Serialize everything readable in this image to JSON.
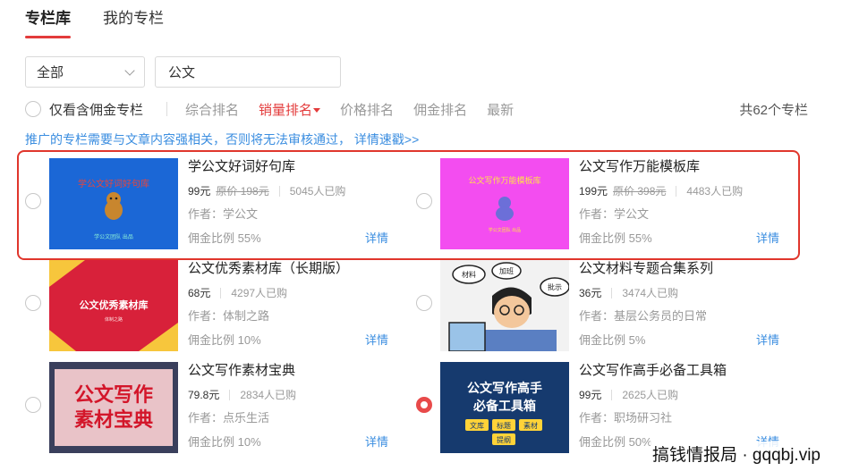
{
  "tabs": [
    {
      "label": "专栏库",
      "active": true
    },
    {
      "label": "我的专栏",
      "active": false
    }
  ],
  "filter": {
    "category": "全部",
    "search_value": "公文"
  },
  "sort": {
    "commission_only_label": "仅看含佣金专栏",
    "options": [
      "综合排名",
      "销量排名",
      "价格排名",
      "佣金排名",
      "最新"
    ],
    "active_option": "销量排名",
    "total": "共62个专栏"
  },
  "notice": "推广的专栏需要与文章内容强相关，否则将无法审核通过， 详情速戳>>",
  "columns": [
    {
      "title": "学公文好词好句库",
      "price": "99元",
      "orig_price": "原价 198元",
      "sold": "5045人已购",
      "author": "作者：学公文",
      "rate": "佣金比例 55%",
      "detail": "详情",
      "thumb": {
        "headline": "学公文好词好句库",
        "footer": "学公文团队 出品",
        "colors": {
          "bg": "#1b67d6",
          "text": "#e8453c",
          "footer": "#8cf0d8"
        }
      }
    },
    {
      "title": "公文写作万能模板库",
      "price": "199元",
      "orig_price": "原价 398元",
      "sold": "4483人已购",
      "author": "作者：学公文",
      "rate": "佣金比例 55%",
      "detail": "详情",
      "thumb": {
        "headline": "公文写作万能模板库",
        "footer": "学公文团队 出品",
        "colors": {
          "bg": "#f34df0",
          "text": "#ffe24a",
          "footer": "#ffe24a"
        }
      }
    },
    {
      "title": "公文优秀素材库（长期版）",
      "price": "68元",
      "sold": "4297人已购",
      "author": "作者：体制之路",
      "rate": "佣金比例 10%",
      "detail": "详情",
      "thumb": {
        "headline": "公文优秀素材库",
        "footer": "体制之路",
        "colors": {
          "bg": "#d8213a",
          "accent": "#f7c63c"
        }
      }
    },
    {
      "title": "公文材料专题合集系列",
      "price": "36元",
      "sold": "3474人已购",
      "author": "作者：基层公务员的日常",
      "rate": "佣金比例 5%",
      "detail": "详情",
      "thumb": {
        "bubbles": [
          "材料",
          "加班",
          "批示"
        ],
        "colors": {
          "bg": "#f2f2f2",
          "accent": "#222"
        }
      }
    },
    {
      "title": "公文写作素材宝典",
      "price": "79.8元",
      "sold": "2834人已购",
      "author": "作者：点乐生活",
      "rate": "佣金比例 10%",
      "detail": "详情",
      "thumb": {
        "headline": "公文写作素材宝典",
        "colors": {
          "bg": "#3a3f5c",
          "text": "#d3162a",
          "panel": "#e9c3c8"
        }
      }
    },
    {
      "title": "公文写作高手必备工具箱",
      "price": "99元",
      "sold": "2625人已购",
      "author": "作者：职场研习社",
      "rate": "佣金比例 50%",
      "detail": "详情",
      "selected": true,
      "thumb": {
        "headline": "公文写作高手必备工具箱",
        "tags": [
          "文库",
          "标题",
          "素材",
          "提纲"
        ],
        "colors": {
          "bg": "#163a6e",
          "text": "#ffffff",
          "tag": "#ffd338"
        }
      }
    }
  ],
  "watermark": "搞钱情报局 · gqqbj.vip"
}
